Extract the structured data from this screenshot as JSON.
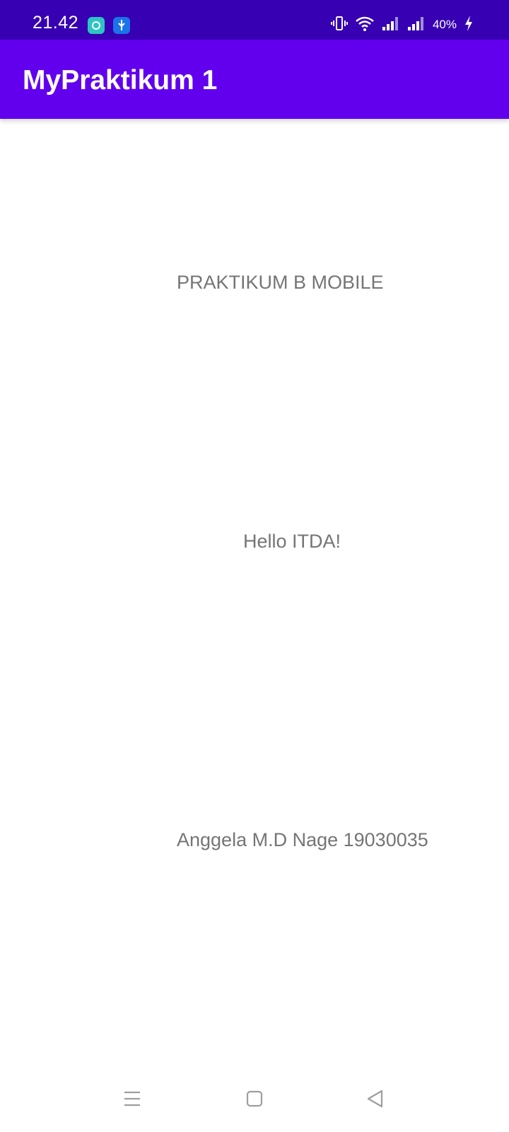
{
  "status_bar": {
    "time": "21.42",
    "battery_level": "40%",
    "icons": [
      "notification-app-icon",
      "usb-icon",
      "vibrate-icon",
      "wifi-icon",
      "signal-icon",
      "signal-icon",
      "charging-icon"
    ]
  },
  "app_bar": {
    "title": "MyPraktikum 1"
  },
  "content": {
    "text_1": "PRAKTIKUM B MOBILE",
    "text_2": "Hello ITDA!",
    "text_3": "Anggela M.D Nage 19030035"
  },
  "navigation_bar": {
    "buttons": [
      "menu-icon",
      "home-icon",
      "back-icon"
    ]
  },
  "colors": {
    "status_bar": "#3700b3",
    "app_bar": "#6200ee",
    "text": "#757575",
    "background": "#ffffff"
  }
}
